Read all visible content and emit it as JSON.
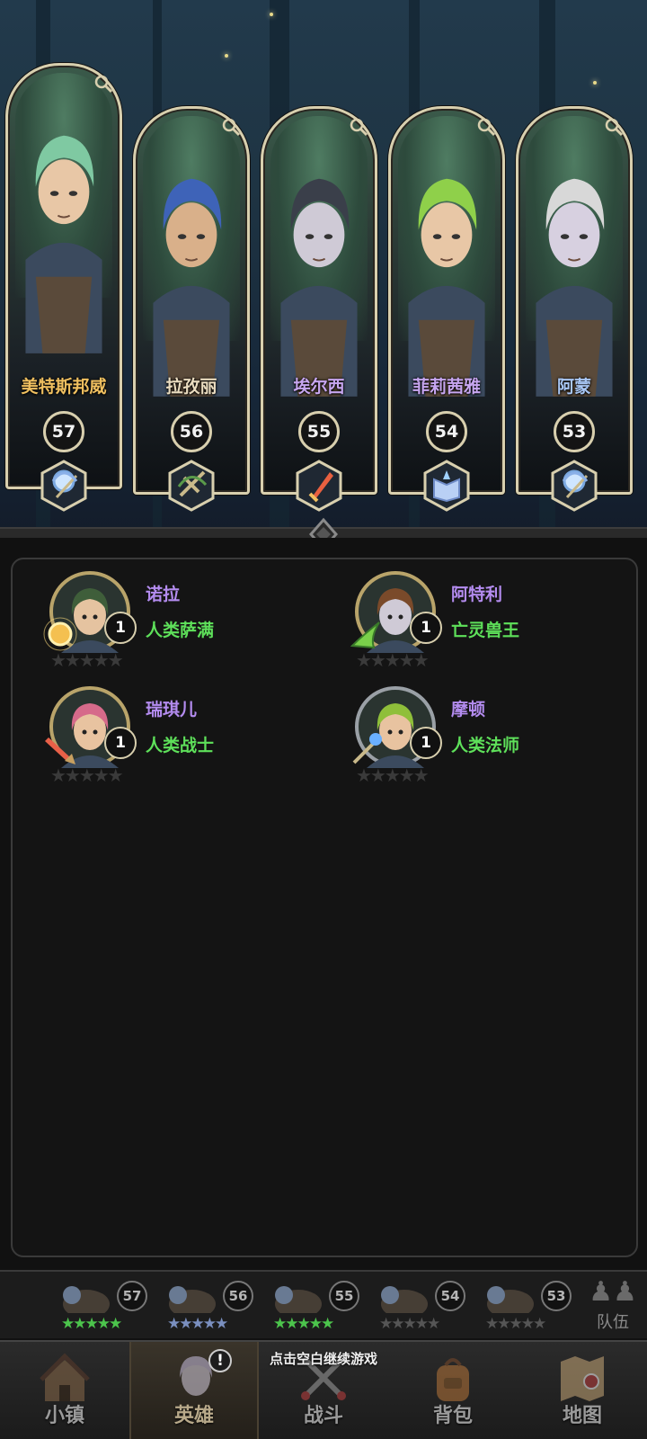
{
  "showcase": {
    "cards": [
      {
        "name": "美特斯邦威",
        "level": "57",
        "name_color": "#f0c060",
        "class_icon": "bow-crystal-icon",
        "hair": "#7fc9a2",
        "skin": "#e8c7a6"
      },
      {
        "name": "拉孜丽",
        "level": "56",
        "name_color": "#eadcc0",
        "class_icon": "crossbow-icon",
        "hair": "#3e63b8",
        "skin": "#d9b08a"
      },
      {
        "name": "埃尔西",
        "level": "55",
        "name_color": "#c7a6f0",
        "class_icon": "sword-icon",
        "hair": "#3a3f4a",
        "skin": "#cfcad6"
      },
      {
        "name": "菲莉茜雅",
        "level": "54",
        "name_color": "#c7a6f0",
        "class_icon": "spellbook-icon",
        "hair": "#8fd04a",
        "skin": "#e8c7a6"
      },
      {
        "name": "阿蒙",
        "level": "53",
        "name_color": "#a9c7f5",
        "class_icon": "bow-crystal-icon",
        "hair": "#d8d8d8",
        "skin": "#d7d0e0"
      }
    ]
  },
  "owned_heroes": [
    {
      "name": "诺拉",
      "class": "人类萨满",
      "rank": "1",
      "stars": "★★★★★",
      "badge": "sun-orb-icon",
      "hair": "#3f5e3a",
      "skin": "#e5c3a0",
      "frame": "#b9a46a"
    },
    {
      "name": "阿特利",
      "class": "亡灵兽王",
      "rank": "1",
      "stars": "★★★★★",
      "badge": "green-claw-icon",
      "hair": "#7a4a2a",
      "skin": "#cfcad6",
      "frame": "#b9a46a"
    },
    {
      "name": "瑞琪儿",
      "class": "人类战士",
      "rank": "1",
      "stars": "★★★★★",
      "badge": "red-sword-icon",
      "hair": "#d66a8a",
      "skin": "#e8c3a0",
      "frame": "#b9a46a"
    },
    {
      "name": "摩顿",
      "class": "人类法师",
      "rank": "1",
      "stars": "★★★★★",
      "badge": "staff-icon",
      "hair": "#8fbf3a",
      "skin": "#e8c3a0",
      "frame": "#9aa0a6"
    }
  ],
  "team": {
    "members": [
      {
        "level": "57",
        "stars": "★★★★★",
        "star_color": "#4cc44c"
      },
      {
        "level": "56",
        "stars": "★★★★★",
        "star_color": "#7a8fbf"
      },
      {
        "level": "55",
        "stars": "★★★★★",
        "star_color": "#4cc44c"
      },
      {
        "level": "54",
        "stars": "★★★★★",
        "star_color": "#555"
      },
      {
        "level": "53",
        "stars": "★★★★★",
        "star_color": "#555"
      }
    ],
    "label": "队伍"
  },
  "nav": {
    "hint": "点击空白继续游戏",
    "tabs": [
      {
        "label": "小镇",
        "icon": "town-icon"
      },
      {
        "label": "英雄",
        "icon": "hero-icon",
        "alert": "!"
      },
      {
        "label": "战斗",
        "icon": "battle-icon"
      },
      {
        "label": "背包",
        "icon": "backpack-icon"
      },
      {
        "label": "地图",
        "icon": "map-icon"
      }
    ]
  }
}
